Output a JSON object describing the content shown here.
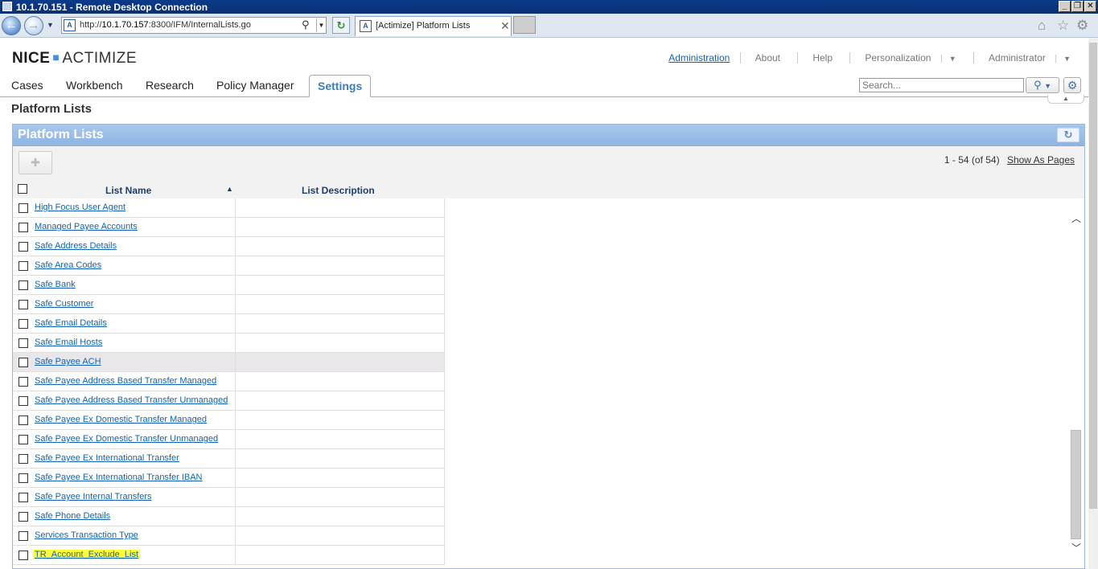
{
  "rdp": {
    "title": "10.1.70.151 - Remote Desktop Connection"
  },
  "browser": {
    "url_prefix": "http://",
    "url_host": "10.1.70.157",
    "url_rest": ":8300/IFM/InternalLists.go",
    "tab_title": "[Actimize] Platform Lists"
  },
  "app": {
    "logo_brand": "NICE",
    "logo_product": "ACTIMIZE",
    "top_links": [
      "Administration",
      "About",
      "Help",
      "Personalization",
      "Administrator"
    ],
    "nav_tabs": [
      "Cases",
      "Workbench",
      "Research",
      "Policy Manager",
      "Settings"
    ],
    "active_tab": "Settings",
    "search_placeholder": "Search..."
  },
  "page": {
    "title": "Platform Lists",
    "panel_title": "Platform Lists",
    "pager_text": "1 - 54 (of 54)",
    "show_as_pages": "Show As Pages",
    "columns": {
      "name": "List Name",
      "description": "List Description"
    },
    "rows": [
      {
        "name": "High Focus User Agent",
        "description": ""
      },
      {
        "name": "Managed Payee Accounts",
        "description": ""
      },
      {
        "name": "Safe Address Details",
        "description": ""
      },
      {
        "name": "Safe Area Codes",
        "description": ""
      },
      {
        "name": "Safe Bank",
        "description": ""
      },
      {
        "name": "Safe Customer",
        "description": ""
      },
      {
        "name": "Safe Email Details",
        "description": ""
      },
      {
        "name": "Safe Email Hosts",
        "description": ""
      },
      {
        "name": "Safe Payee ACH",
        "description": ""
      },
      {
        "name": "Safe Payee Address Based Transfer Managed",
        "description": ""
      },
      {
        "name": "Safe Payee Address Based Transfer Unmanaged",
        "description": ""
      },
      {
        "name": "Safe Payee Ex Domestic Transfer Managed",
        "description": ""
      },
      {
        "name": "Safe Payee Ex Domestic Transfer Unmanaged",
        "description": ""
      },
      {
        "name": "Safe Payee Ex International Transfer",
        "description": ""
      },
      {
        "name": "Safe Payee Ex International Transfer IBAN",
        "description": ""
      },
      {
        "name": "Safe Payee Internal Transfers",
        "description": ""
      },
      {
        "name": "Safe Phone Details",
        "description": ""
      },
      {
        "name": "Services Transaction Type",
        "description": ""
      },
      {
        "name": "TR_Account_Exclude_List",
        "description": ""
      }
    ],
    "hover_row": "Safe Payee ACH",
    "highlighted_row": "TR_Account_Exclude_List"
  },
  "colors": {
    "accent": "#3a7bc8",
    "panel_header": "#8db4e2",
    "link": "#1264b3",
    "highlight": "#ffff33"
  }
}
